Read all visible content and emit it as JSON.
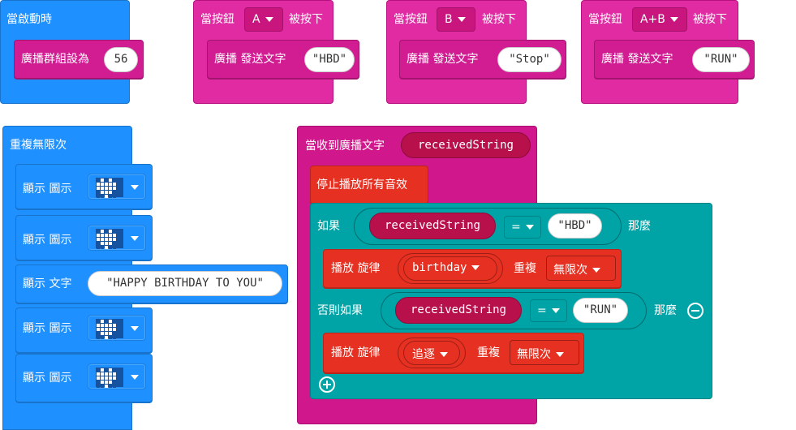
{
  "on_start": {
    "label": "當啟動時",
    "set_group_label": "廣播群組設為",
    "group_value": "56"
  },
  "button_a": {
    "when": "當按鈕",
    "button": "A",
    "pressed": "被按下",
    "broadcast": "廣播 發送文字",
    "text": "\"HBD\""
  },
  "button_b": {
    "when": "當按鈕",
    "button": "B",
    "pressed": "被按下",
    "broadcast": "廣播 發送文字",
    "text": "\"Stop\""
  },
  "button_ab": {
    "when": "當按鈕",
    "button": "A+B",
    "pressed": "被按下",
    "broadcast": "廣播 發送文字",
    "text": "\"RUN\""
  },
  "forever": {
    "label": "重複無限次",
    "rows": [
      {
        "kind": "image",
        "label": "顯示 圖示",
        "pattern": [
          0,
          1,
          0,
          1,
          0,
          1,
          1,
          1,
          1,
          1,
          1,
          1,
          1,
          1,
          1,
          0,
          1,
          1,
          1,
          0,
          0,
          0,
          1,
          0,
          0
        ]
      },
      {
        "kind": "image",
        "label": "顯示 圖示",
        "pattern": [
          0,
          1,
          0,
          1,
          0,
          1,
          1,
          1,
          1,
          1,
          1,
          1,
          1,
          1,
          1,
          0,
          1,
          1,
          1,
          0,
          0,
          0,
          1,
          0,
          0
        ]
      },
      {
        "kind": "text",
        "label": "顯示 文字",
        "value": "\"HAPPY BIRTHDAY TO YOU\""
      },
      {
        "kind": "image",
        "label": "顯示 圖示",
        "pattern": [
          0,
          1,
          0,
          1,
          0,
          1,
          1,
          1,
          1,
          1,
          1,
          1,
          1,
          1,
          1,
          0,
          1,
          1,
          1,
          0,
          0,
          0,
          1,
          0,
          0
        ]
      },
      {
        "kind": "image",
        "label": "顯示 圖示",
        "pattern": [
          0,
          1,
          0,
          1,
          0,
          1,
          1,
          1,
          1,
          1,
          1,
          1,
          1,
          1,
          1,
          0,
          1,
          1,
          1,
          0,
          0,
          0,
          1,
          0,
          0
        ]
      }
    ]
  },
  "on_received": {
    "label": "當收到廣播文字",
    "var": "receivedString",
    "stop_all": "停止播放所有音效",
    "if_label": "如果",
    "cond1_var": "receivedString",
    "op": "=",
    "cond1_value": "\"HBD\"",
    "then": "那麼",
    "play1_label": "播放 旋律",
    "play1_melody": "birthday",
    "repeat_label": "重複",
    "play1_repeat": "無限次",
    "elseif_label": "否則如果",
    "cond2_var": "receivedString",
    "cond2_value": "\"RUN\"",
    "play2_label": "播放 旋律",
    "play2_melody": "追逐",
    "play2_repeat": "無限次"
  },
  "icons": {
    "minus": "minus-circle-icon",
    "plus": "plus-circle-icon",
    "dropdown": "caret-down-icon"
  },
  "colors": {
    "basic_blue": "#1e90ff",
    "radio_magenta": "#e02ba2",
    "music_red": "#e63022",
    "logic_teal": "#00a4a6"
  }
}
